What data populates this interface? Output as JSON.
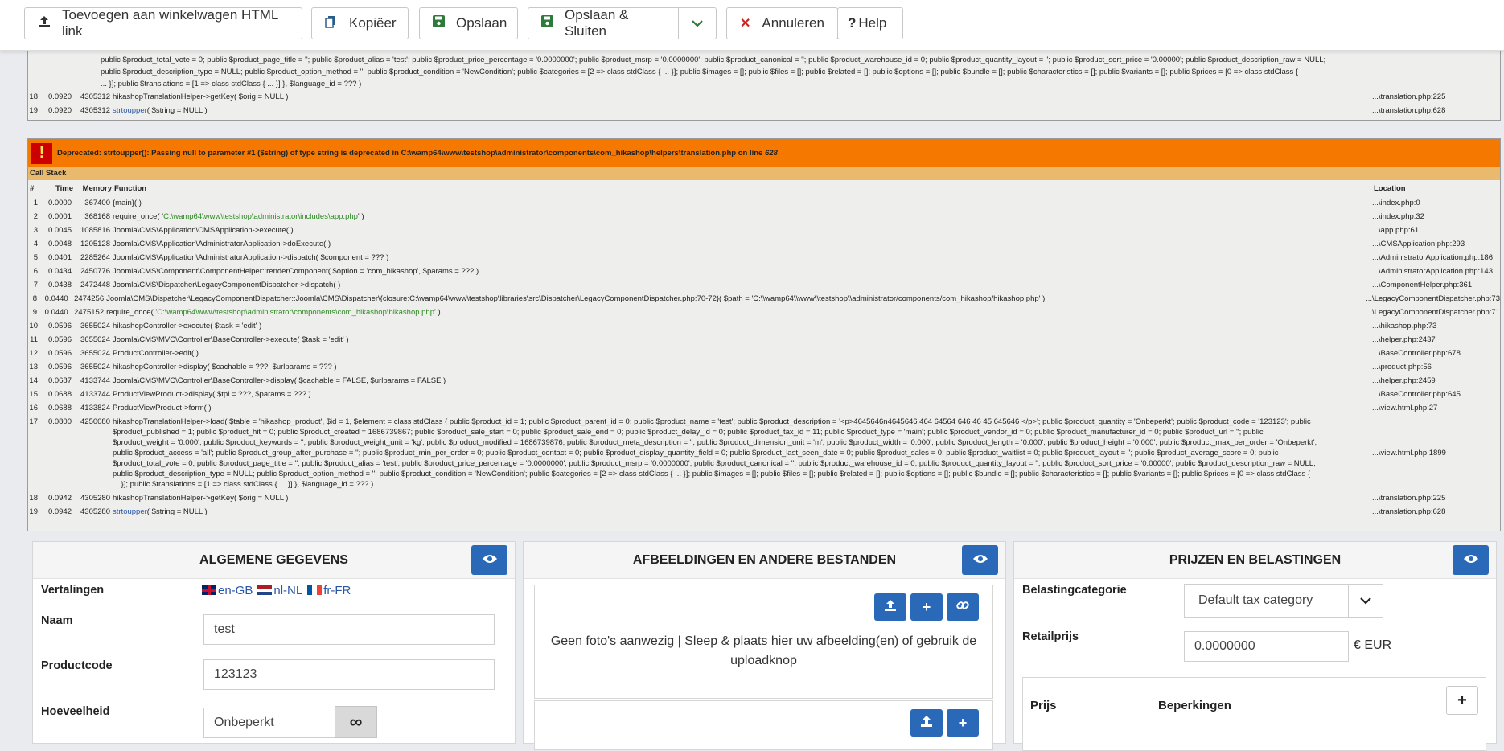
{
  "toolbar": {
    "add_cart_link": "Toevoegen aan winkelwagen HTML link",
    "copy": "Kopiëer",
    "save": "Opslaan",
    "save_close": "Opslaan & Sluiten",
    "cancel": "Annuleren",
    "help": "Help"
  },
  "top_fragment": {
    "lines": [
      "public $product_total_vote = 0; public $product_page_title = ''; public $product_alias = 'test'; public $product_price_percentage = '0.0000000'; public $product_msrp = '0.0000000'; public $product_canonical = ''; public $product_warehouse_id = 0; public $product_quantity_layout = ''; public $product_sort_price = '0.00000'; public $product_description_raw = NULL;",
      "public $product_description_type = NULL; public $product_option_method = ''; public $product_condition = 'NewCondition'; public $categories = [2 => class stdClass { ... }]; public $images = []; public $files = []; public $related = []; public $options = []; public $bundle = []; public $characteristics = []; public $variants = []; public $prices = [0 => class stdClass {",
      "... }]; public $translations = [1 => class stdClass { ... }] }, $language_id = ??? )"
    ],
    "rows": [
      {
        "n": "18",
        "t": "0.0920",
        "m": "4305312",
        "f": "hikashopTranslationHelper->getKey( $orig = NULL )",
        "loc": "...\\translation.php:225"
      },
      {
        "n": "19",
        "t": "0.0920",
        "m": "4305312",
        "fpre": "strtoupper",
        "fpost": "( $string = NULL )",
        "loc": "...\\translation.php:628"
      }
    ]
  },
  "error": {
    "icon": "( ! )",
    "message": "Deprecated: strtoupper(): Passing null to parameter #1 ($string) of type string is deprecated in C:\\wamp64\\www\\testshop\\administrator\\components\\com_hikashop\\helpers\\translation.php on line",
    "line": "628",
    "callstack": "Call Stack",
    "cols": {
      "n": "#",
      "t": "Time",
      "m": "Memory",
      "f": "Function",
      "loc": "Location"
    },
    "rows": [
      {
        "n": "1",
        "t": "0.0000",
        "m": "367400",
        "f": "{main}( )",
        "loc": "...\\index.php:0"
      },
      {
        "n": "2",
        "t": "0.0001",
        "m": "368168",
        "fpre": "require_once( '",
        "green": "C:\\wamp64\\www\\testshop\\administrator\\includes\\app.php",
        "fpost": "' )",
        "loc": "...\\index.php:32"
      },
      {
        "n": "3",
        "t": "0.0045",
        "m": "1085816",
        "f": "Joomla\\CMS\\Application\\CMSApplication->execute( )",
        "loc": "...\\app.php:61"
      },
      {
        "n": "4",
        "t": "0.0048",
        "m": "1205128",
        "f": "Joomla\\CMS\\Application\\AdministratorApplication->doExecute( )",
        "loc": "...\\CMSApplication.php:293"
      },
      {
        "n": "5",
        "t": "0.0401",
        "m": "2285264",
        "f": "Joomla\\CMS\\Application\\AdministratorApplication->dispatch( $component = ??? )",
        "loc": "...\\AdministratorApplication.php:186"
      },
      {
        "n": "6",
        "t": "0.0434",
        "m": "2450776",
        "f": "Joomla\\CMS\\Component\\ComponentHelper::renderComponent( $option = 'com_hikashop', $params = ??? )",
        "loc": "...\\AdministratorApplication.php:143"
      },
      {
        "n": "7",
        "t": "0.0438",
        "m": "2472448",
        "f": "Joomla\\CMS\\Dispatcher\\LegacyComponentDispatcher->dispatch( )",
        "loc": "...\\ComponentHelper.php:361"
      },
      {
        "n": "8",
        "t": "0.0440",
        "m": "2474256",
        "f": "Joomla\\CMS\\Dispatcher\\LegacyComponentDispatcher::Joomla\\CMS\\Dispatcher\\{closure:C:\\wamp64\\www\\testshop\\libraries\\src\\Dispatcher\\LegacyComponentDispatcher.php:70-72}( $path = 'C:\\\\wamp64\\\\www\\\\testshop\\\\administrator/components/com_hikashop/hikashop.php' )",
        "loc": "...\\LegacyComponentDispatcher.php:73"
      },
      {
        "n": "9",
        "t": "0.0440",
        "m": "2475152",
        "fpre": "require_once( '",
        "green": "C:\\wamp64\\www\\testshop\\administrator\\components\\com_hikashop\\hikashop.php",
        "fpost": "' )",
        "loc": "...\\LegacyComponentDispatcher.php:71"
      },
      {
        "n": "10",
        "t": "0.0596",
        "m": "3655024",
        "f": "hikashopController->execute( $task = 'edit' )",
        "loc": "...\\hikashop.php:73"
      },
      {
        "n": "11",
        "t": "0.0596",
        "m": "3655024",
        "f": "Joomla\\CMS\\MVC\\Controller\\BaseController->execute( $task = 'edit' )",
        "loc": "...\\helper.php:2437"
      },
      {
        "n": "12",
        "t": "0.0596",
        "m": "3655024",
        "f": "ProductController->edit( )",
        "loc": "...\\BaseController.php:678"
      },
      {
        "n": "13",
        "t": "0.0596",
        "m": "3655024",
        "f": "hikashopController->display( $cachable = ???, $urlparams = ??? )",
        "loc": "...\\product.php:56"
      },
      {
        "n": "14",
        "t": "0.0687",
        "m": "4133744",
        "f": "Joomla\\CMS\\MVC\\Controller\\BaseController->display( $cachable = FALSE, $urlparams = FALSE )",
        "loc": "...\\helper.php:2459"
      },
      {
        "n": "15",
        "t": "0.0688",
        "m": "4133744",
        "f": "ProductViewProduct->display( $tpl = ???, $params = ??? )",
        "loc": "...\\BaseController.php:645"
      },
      {
        "n": "16",
        "t": "0.0688",
        "m": "4133824",
        "f": "ProductViewProduct->form( )",
        "loc": "...\\view.html.php:27"
      }
    ],
    "row17": {
      "n": "17",
      "t": "0.0800",
      "m": "4250080",
      "loc": "...\\view.html.php:1899",
      "lines": [
        "hikashopTranslationHelper->load( $table = 'hikashop_product', $id = 1, $element = class stdClass { public $product_id = 1; public $product_parent_id = 0; public $product_name = 'test'; public $product_description = '<p>4645646n4645646 464 64564 646 46 45 645646 </p>'; public $product_quantity = 'Onbeperkt'; public $product_code = '123123'; public",
        "$product_published = 1; public $product_hit = 0; public $product_created = 1686739867; public $product_sale_start = 0; public $product_sale_end = 0; public $product_delay_id = 0; public $product_tax_id = 11; public $product_type = 'main'; public $product_vendor_id = 0; public $product_manufacturer_id = 0; public $product_url = ''; public",
        "$product_weight = '0.000'; public $product_keywords = ''; public $product_weight_unit = 'kg'; public $product_modified = 1686739876; public $product_meta_description = ''; public $product_dimension_unit = 'm'; public $product_width = '0.000'; public $product_length = '0.000'; public $product_height = '0.000'; public $product_max_per_order = 'Onbeperkt';",
        "public $product_access = 'all'; public $product_group_after_purchase = ''; public $product_min_per_order = 0; public $product_contact = 0; public $product_display_quantity_field = 0; public $product_last_seen_date = 0; public $product_sales = 0; public $product_waitlist = 0; public $product_layout = ''; public $product_average_score = 0; public",
        "$product_total_vote = 0; public $product_page_title = ''; public $product_alias = 'test'; public $product_price_percentage = '0.0000000'; public $product_msrp = '0.0000000'; public $product_canonical = ''; public $product_warehouse_id = 0; public $product_quantity_layout = ''; public $product_sort_price = '0.00000'; public $product_description_raw = NULL;",
        "public $product_description_type = NULL; public $product_option_method = ''; public $product_condition = 'NewCondition'; public $categories = [2 => class stdClass { ... }]; public $images = []; public $files = []; public $related = []; public $options = []; public $bundle = []; public $characteristics = []; public $variants = []; public $prices = [0 => class stdClass {",
        "... }]; public $translations = [1 => class stdClass { ... }] }, $language_id = ??? )"
      ]
    },
    "tail": [
      {
        "n": "18",
        "t": "0.0942",
        "m": "4305280",
        "f": "hikashopTranslationHelper->getKey( $orig = NULL )",
        "loc": "...\\translation.php:225"
      },
      {
        "n": "19",
        "t": "0.0942",
        "m": "4305280",
        "fpre": "strtoupper",
        "fpost": "( $string = NULL )",
        "loc": "...\\translation.php:628"
      }
    ]
  },
  "general": {
    "title": "ALGEMENE GEGEVENS",
    "translations_label": "Vertalingen",
    "langs": [
      "en-GB",
      "nl-NL",
      "fr-FR"
    ],
    "name_label": "Naam",
    "name_value": "test",
    "code_label": "Productcode",
    "code_value": "123123",
    "qty_label": "Hoeveelheid",
    "qty_value": "Onbeperkt",
    "infinity": "∞"
  },
  "images": {
    "title": "AFBEELDINGEN EN ANDERE BESTANDEN",
    "empty_text": "Geen foto's aanwezig | Sleep & plaats hier uw afbeelding(en) of gebruik de uploadknop"
  },
  "prices": {
    "title": "PRIJZEN EN BELASTINGEN",
    "tax_label": "Belastingcategorie",
    "tax_value": "Default tax category",
    "retail_label": "Retailprijs",
    "retail_value": "0.0000000",
    "currency": "€ EUR",
    "col_price": "Prijs",
    "col_limits": "Beperkingen"
  },
  "colors": {
    "accent": "#2a69b8",
    "error_bar": "#f57900",
    "callstack_bar": "#e9b96e"
  }
}
